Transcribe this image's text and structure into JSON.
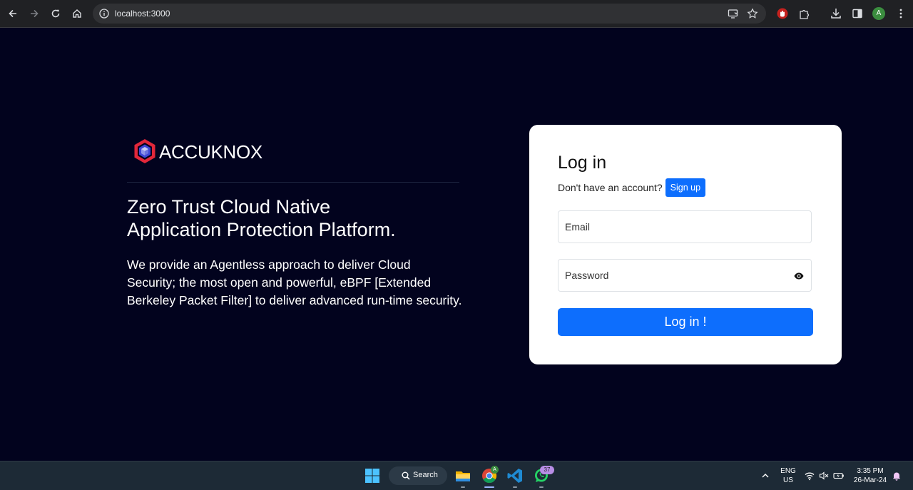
{
  "browser": {
    "url": "localhost:3000",
    "profile_initial": "A"
  },
  "brand": {
    "name": "ACCUKNOX",
    "colors": {
      "accent": "#0d6efd",
      "background": "#02031e",
      "logo_red": "#e2273a",
      "logo_blue": "#3d46d6"
    }
  },
  "hero": {
    "headline_line1": "Zero Trust Cloud Native",
    "headline_line2": "Application Protection Platform.",
    "description": "We provide an Agentless approach to deliver Cloud Security; the most open and powerful, eBPF [Extended Berkeley Packet Filter] to deliver advanced run-time security."
  },
  "login": {
    "title": "Log in",
    "no_account_text": "Don't have an account?",
    "signup_label": "Sign up",
    "email_placeholder": "Email",
    "password_placeholder": "Password",
    "submit_label": "Log in !"
  },
  "taskbar": {
    "search_label": "Search",
    "whatsapp_badge": "37",
    "chrome_badge": "A",
    "lang": "ENG",
    "region": "US",
    "time": "3:35 PM",
    "date": "26-Mar-24"
  }
}
